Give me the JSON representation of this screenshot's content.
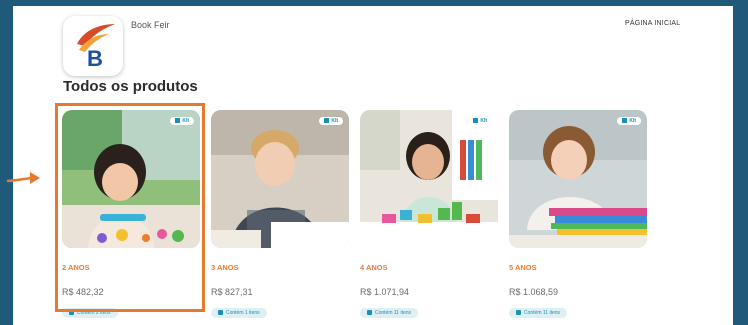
{
  "header": {
    "brand_name": "Book Feir",
    "logo_letter": "B",
    "nav_home": "PÁGINA INICIAL"
  },
  "page": {
    "title": "Todos os produtos"
  },
  "products": [
    {
      "age": "2 ANOS",
      "price": "R$ 482,32",
      "items": "Contém 2 itens",
      "badge": "KIt"
    },
    {
      "age": "3 ANOS",
      "price": "R$ 827,31",
      "items": "Contém 1 itens",
      "badge": "KIt"
    },
    {
      "age": "4 ANOS",
      "price": "R$ 1.071,94",
      "items": "Contém 11 itens",
      "badge": "KIt"
    },
    {
      "age": "5 ANOS",
      "price": "R$ 1.068,59",
      "items": "Contém 11 itens",
      "badge": "KIt"
    }
  ],
  "colors": {
    "frame_background": "#1f5a7a",
    "accent_orange": "#ec7b2f",
    "accent_teal": "#1b8fb6",
    "logo_blue": "#1b4fa0",
    "logo_red": "#d94a2b"
  },
  "icons": {
    "kit_badge_icon": "box-icon",
    "items_icon": "bag-icon",
    "pointer": "arrow-right-icon"
  }
}
